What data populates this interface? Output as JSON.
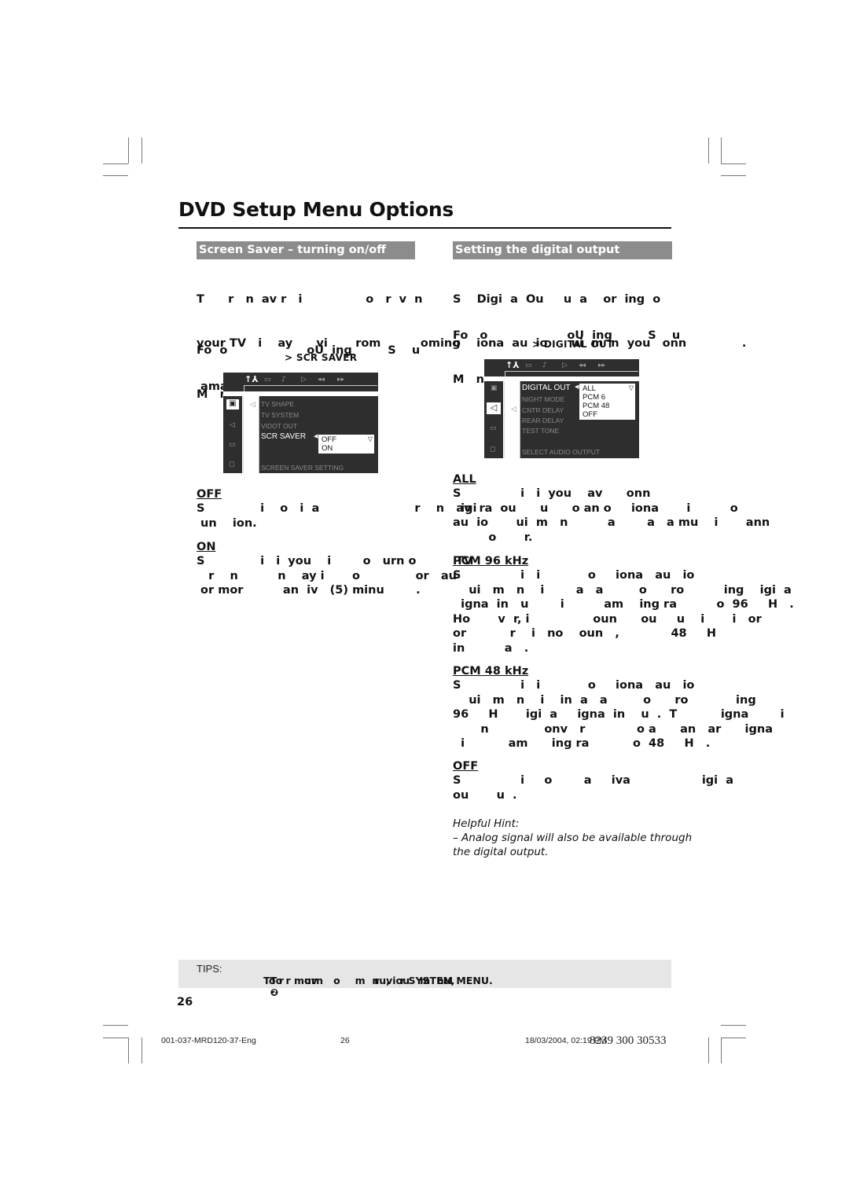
{
  "page": {
    "title": "DVD Setup Menu Options",
    "page_number": "26"
  },
  "left": {
    "section_title": "Screen Saver – turning on/off",
    "intro": [
      "T      r   n  av r   i                o   r  v  n",
      "your TV   i    ay      vi       rom          oming",
      " amag     ."
    ],
    "follow": [
      "Fo  o                    oU  ing         S    u",
      "M   nu  an"
    ],
    "menu_path_arrow": ">",
    "menu_path": "SCR SAVER",
    "osd": {
      "items": [
        "TV SHAPE",
        "TV SYSTEM",
        "VIDOT OUT",
        "SCR SAVER"
      ],
      "active_item": "SCR SAVER",
      "options": [
        "OFF",
        "ON"
      ],
      "status": "SCREEN SAVER SETTING"
    },
    "options": [
      {
        "label": "OFF",
        "text": [
          "S              i    o   i  a                        r    n   av  r",
          " un    ion."
        ]
      },
      {
        "label": "ON",
        "text": [
          "S              i   i  you    i        o   urn o          TV",
          "   r    n          n    ay i       o              or   au",
          " or mor          an  iv   (5) minu        ."
        ]
      }
    ]
  },
  "right": {
    "section_title": "Setting the digital output",
    "intro": [
      "S    Digi  a  Ou     u  a    or  ing  o",
      "o    iona  au  io      ui  m  n  you   onn              ."
    ],
    "follow": [
      "Fo   o                    oU  ing         S    u",
      "M   nu  an"
    ],
    "menu_path_arrow": ">",
    "menu_path": "DIGITAL OUT",
    "osd": {
      "items": [
        "DIGITAL OUT",
        "NIGHT MODE",
        "CNTR DELAY",
        "REAR DELAY",
        "TEST TONE"
      ],
      "active_item": "DIGITAL OUT",
      "options": [
        "ALL",
        "PCM   6",
        "PCM 48",
        "OFF"
      ],
      "status": "SELECT AUDIO OUTPUT"
    },
    "options": [
      {
        "label": "ALL",
        "text": [
          "S               i   i  you    av      onn",
          "  igi  a  ou      u      o an o     iona       i          o",
          "au  io       ui  m   n          a        a   a mu    i       ann",
          "         o       r."
        ]
      },
      {
        "label": "PCM 96 kHz",
        "text": [
          "S               i   i            o     iona   au   io",
          "    ui   m   n    i        a   a         o      ro          ing    igi  a",
          "  igna  in   u        i          am    ing ra          o  96     H   .",
          "Ho       v  r, i                oun      ou     u    i       i   or",
          "or           r    i   no    oun   ,             48     H",
          "in          a   ."
        ]
      },
      {
        "label": "PCM 48 kHz",
        "text": [
          "S               i   i            o     iona   au   io",
          "    ui   m   n    i    in  a   a         o      ro            ing",
          "96     H       igi  a     igna  in    u  .  T           igna        i",
          "       n              onv   r             o a      an   ar      igna",
          "  i           am      ing ra           o  48     H   ."
        ]
      },
      {
        "label": "OFF",
        "text": [
          "S               i     o        a     iva                  igi  a",
          "ou       u  ."
        ]
      }
    ],
    "hint_title": "Helpful Hint:",
    "hint_lines": [
      "–  Analog signal will also be available through",
      "the digital output."
    ]
  },
  "tips": {
    "label": "TIPS:",
    "line1": "To r    urn   o          r  viou   m  nu,",
    "line1_icon": "❷",
    "line2": "To r   mov           m  nu,   r SYSTEM MENU."
  },
  "footer": {
    "file": "001-037-MRD120-37-Eng",
    "page": "26",
    "date": "18/03/2004, 02:19 PM",
    "code": "8239 300 30533"
  }
}
